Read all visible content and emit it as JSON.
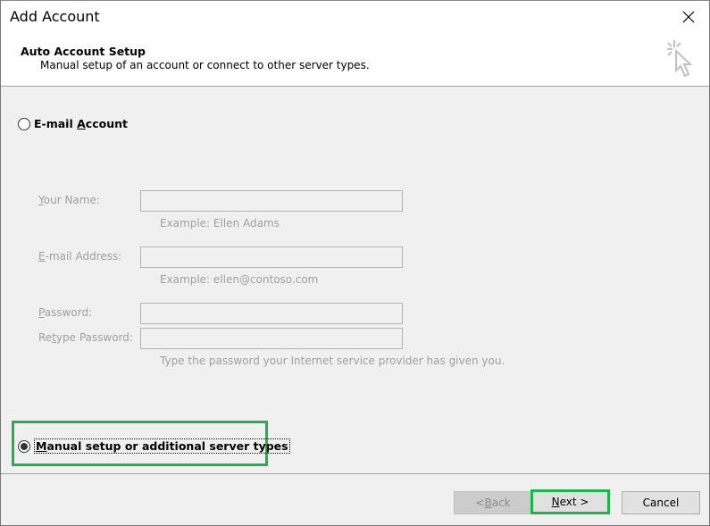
{
  "window": {
    "title": "Add Account",
    "close_icon": "close-icon"
  },
  "header": {
    "title": "Auto Account Setup",
    "subtitle": "Manual setup of an account or connect to other server types.",
    "icon": "click-cursor-icon"
  },
  "options": {
    "email_account": {
      "label_pre": "E-mail ",
      "label_accel": "A",
      "label_post": "ccount",
      "selected": false
    },
    "manual_setup": {
      "label_accel": "M",
      "label_post": "anual setup or additional server types",
      "selected": true
    }
  },
  "form": {
    "your_name": {
      "label_accel": "Y",
      "label_post": "our Name:",
      "value": "",
      "hint": "Example: Ellen Adams"
    },
    "email_address": {
      "label_accel": "E",
      "label_post": "-mail Address:",
      "value": "",
      "hint": "Example: ellen@contoso.com"
    },
    "password": {
      "label_accel": "P",
      "label_post": "assword:",
      "value": ""
    },
    "retype_password": {
      "label_pre": "Re",
      "label_accel": "t",
      "label_post": "ype Password:",
      "value": "",
      "hint": "Type the password your Internet service provider has given you."
    }
  },
  "buttons": {
    "back": {
      "label_pre": "< ",
      "label_accel": "B",
      "label_post": "ack",
      "enabled": false
    },
    "next": {
      "label_accel": "N",
      "label_post": "ext >",
      "enabled": true
    },
    "cancel": {
      "label": "Cancel",
      "enabled": true
    }
  },
  "colors": {
    "highlight": "#22b14c",
    "disabled_text": "#a0a0a0"
  }
}
